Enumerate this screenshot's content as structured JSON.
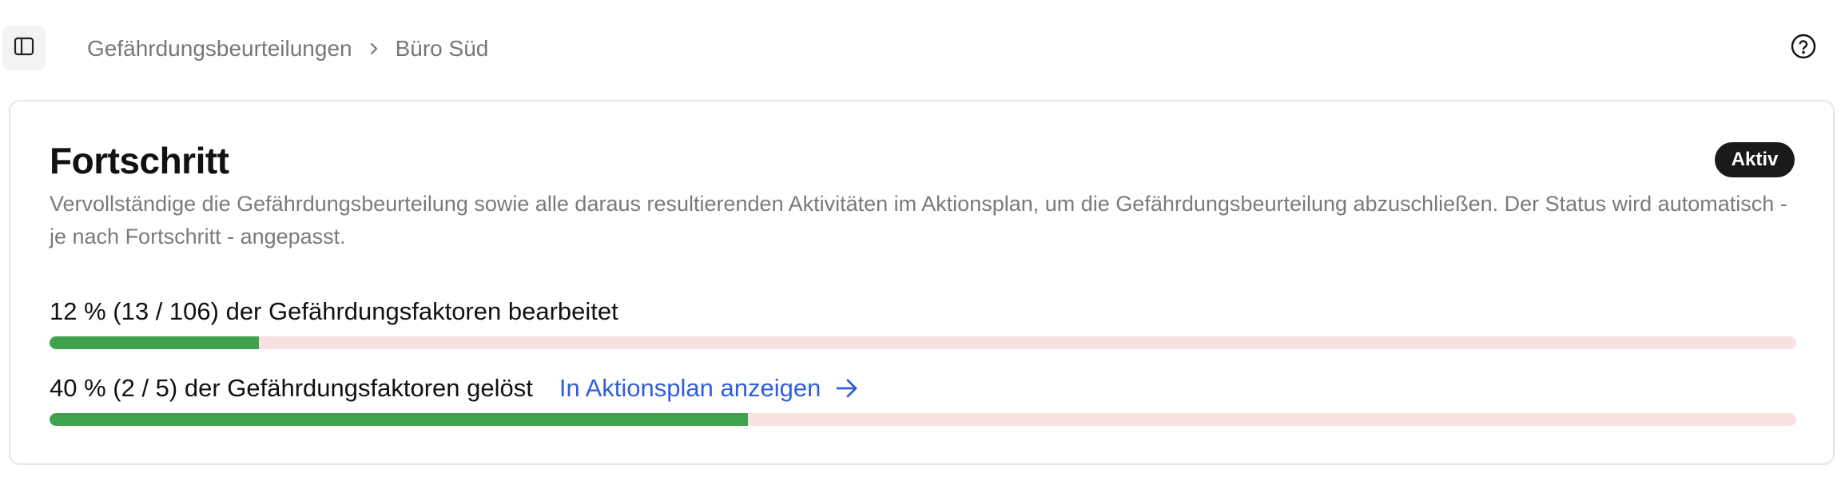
{
  "breadcrumb": {
    "items": [
      "Gefährdungsbeurteilungen",
      "Büro Süd"
    ]
  },
  "icons": {
    "sidebar_toggle": "sidebar-panel-icon",
    "breadcrumb_separator": "chevron-right-icon",
    "help": "help-circle-icon",
    "action_arrow": "arrow-right-icon"
  },
  "card": {
    "title": "Fortschritt",
    "badge": "Aktiv",
    "description": "Vervollständige die Gefährdungsbeurteilung sowie alle daraus resultierenden Aktivitäten im Aktionsplan, um die Gefährdungsbeurteilung abzuschließen. Der Status wird automatisch - je nach Fortschritt - angepasst."
  },
  "progress": [
    {
      "label": "12 % (13 / 106) der Gefährdungsfaktoren bearbeitet",
      "percent": 12
    },
    {
      "label": "40 % (2 / 5) der Gefährdungsfaktoren gelöst",
      "percent": 40,
      "link_label": "In Aktionsplan anzeigen"
    }
  ],
  "colors": {
    "progress_fill": "#3fa34d",
    "progress_track": "#f9e1e1",
    "link": "#2f5fe0",
    "badge_bg": "#1a1a1a"
  }
}
